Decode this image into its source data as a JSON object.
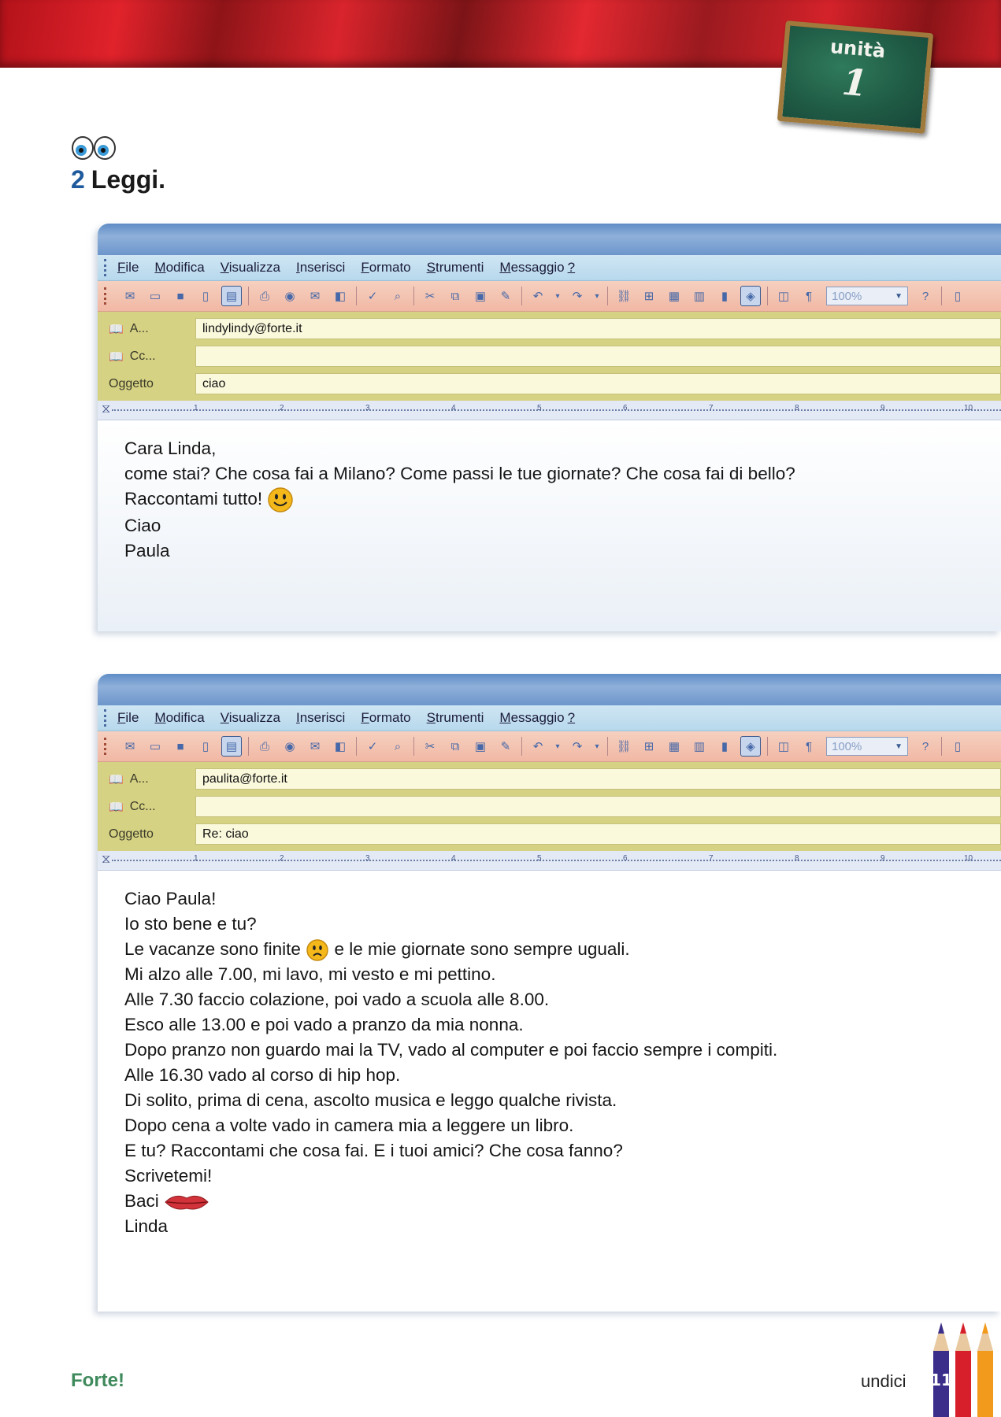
{
  "unit": {
    "label": "unità",
    "number": "1"
  },
  "exercise": {
    "number": "2",
    "title": "Leggi."
  },
  "colors": {
    "banner": "#d9242c",
    "window_titlebar": "#6d96cb",
    "menubar": "#b7d8ec",
    "toolbar": "#f1b8a5",
    "header_fields": "#d6d283",
    "brand": "#3f8a5c"
  },
  "menu": [
    {
      "first": "F",
      "rest": "ile"
    },
    {
      "first": "M",
      "rest": "odifica"
    },
    {
      "first": "V",
      "rest": "isualizza"
    },
    {
      "first": "I",
      "rest": "nserisci"
    },
    {
      "first": "F",
      "rest": "ormato"
    },
    {
      "first": "S",
      "rest": "trumenti"
    },
    {
      "first": "M",
      "rest": "essaggio"
    },
    {
      "first": "?",
      "rest": ""
    }
  ],
  "toolbar": {
    "zoom": "100%"
  },
  "ruler": [
    "1",
    "2",
    "3",
    "4",
    "5",
    "6",
    "7",
    "8",
    "9",
    "10"
  ],
  "email1": {
    "to_label": "A...",
    "cc_label": "Cc...",
    "subject_label": "Oggetto",
    "to": "lindylindy@forte.it",
    "cc": "",
    "subject": "ciao",
    "lines": [
      "Cara Linda,",
      "come stai? Che cosa fai a Milano? Come passi le tue giornate? Che cosa fai di bello?",
      "Raccontami tutto!",
      "Ciao",
      "Paula"
    ]
  },
  "email2": {
    "to_label": "A...",
    "cc_label": "Cc...",
    "subject_label": "Oggetto",
    "to": "paulita@forte.it",
    "cc": "",
    "subject": "Re: ciao",
    "lines": [
      "Ciao Paula!",
      "Io sto bene e tu?",
      "Le vacanze sono finite",
      "e le mie giornate sono sempre uguali.",
      "Mi alzo alle 7.00, mi lavo, mi vesto e mi pettino.",
      "Alle 7.30 faccio colazione, poi vado a scuola alle 8.00.",
      "Esco alle 13.00 e poi vado a pranzo da mia nonna.",
      "Dopo pranzo non guardo mai la TV, vado al computer e poi faccio sempre i compiti.",
      "Alle 16.30 vado al corso di hip hop.",
      "Di solito, prima di cena, ascolto musica e leggo qualche rivista.",
      "Dopo cena a volte vado in camera mia a leggere un libro.",
      "E tu? Raccontami che cosa fai. E i tuoi amici? Che cosa fanno?",
      "Scrivetemi!",
      "Baci",
      "Linda"
    ]
  },
  "footer": {
    "brand": "Forte!",
    "page_word": "undici",
    "page_number": "11"
  }
}
